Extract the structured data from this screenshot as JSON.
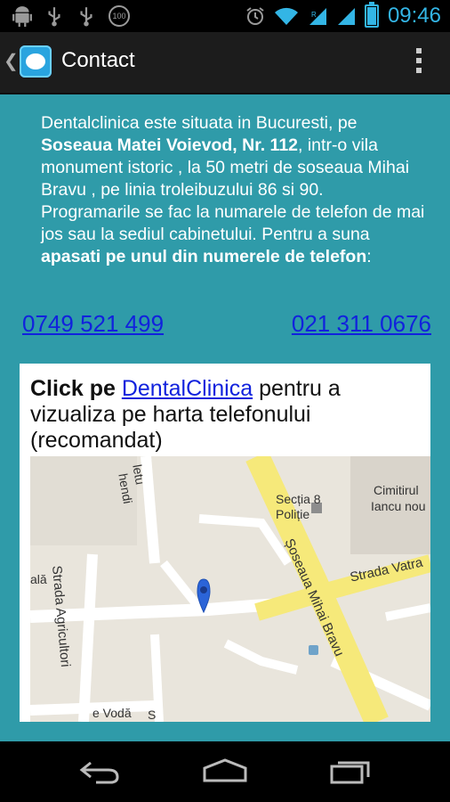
{
  "status_bar": {
    "time": "09:46",
    "badge": "100",
    "left_icons": [
      "android-icon",
      "usb-icon",
      "usb-icon",
      "badge-100-icon"
    ],
    "right_icons": [
      "alarm-icon",
      "wifi-icon",
      "signal-icon",
      "signal-icon",
      "battery-icon"
    ]
  },
  "action_bar": {
    "title": "Contact",
    "back_glyph": "❮"
  },
  "intro": {
    "p1_a": "Dentalclinica este situata in Bucuresti, pe ",
    "p1_bold": "Soseaua Matei Voievod, Nr. 112",
    "p1_b": ", intr-o vila monument istoric , la 50 metri de soseaua Mihai Bravu , pe linia troleibuzului  86  si 90.",
    "p2_a": "Programarile se fac la numarele de telefon de mai jos sau la sediul cabinetului. Pentru a suna ",
    "p2_bold": "apasati pe unul din numerele de telefon",
    "p2_b": ":"
  },
  "phones": [
    "0749 521 499",
    "021 311 0676"
  ],
  "card": {
    "bold": "Click pe ",
    "link": "DentalClinica",
    "rest": " pentru a vizualiza pe harta telefonului (recomandat)"
  },
  "map_labels": {
    "sectia": "Secția 8",
    "politie": "Poliție",
    "cimitirul": "Cimitirul",
    "iancu": "Iancu nou",
    "soseaua": "Șoseaua Mihai Bravu",
    "vatra": "Strada Vatra",
    "agricultori": "Strada Agricultori",
    "ala": "ală",
    "voda": "e Vodă",
    "s": "S",
    "nicuhenti": "hendi",
    "leti": "letu"
  },
  "colors": {
    "background": "#2f9ba9",
    "link": "#1122dd",
    "accent": "#33b5e5",
    "road_major": "#f6e97a"
  }
}
